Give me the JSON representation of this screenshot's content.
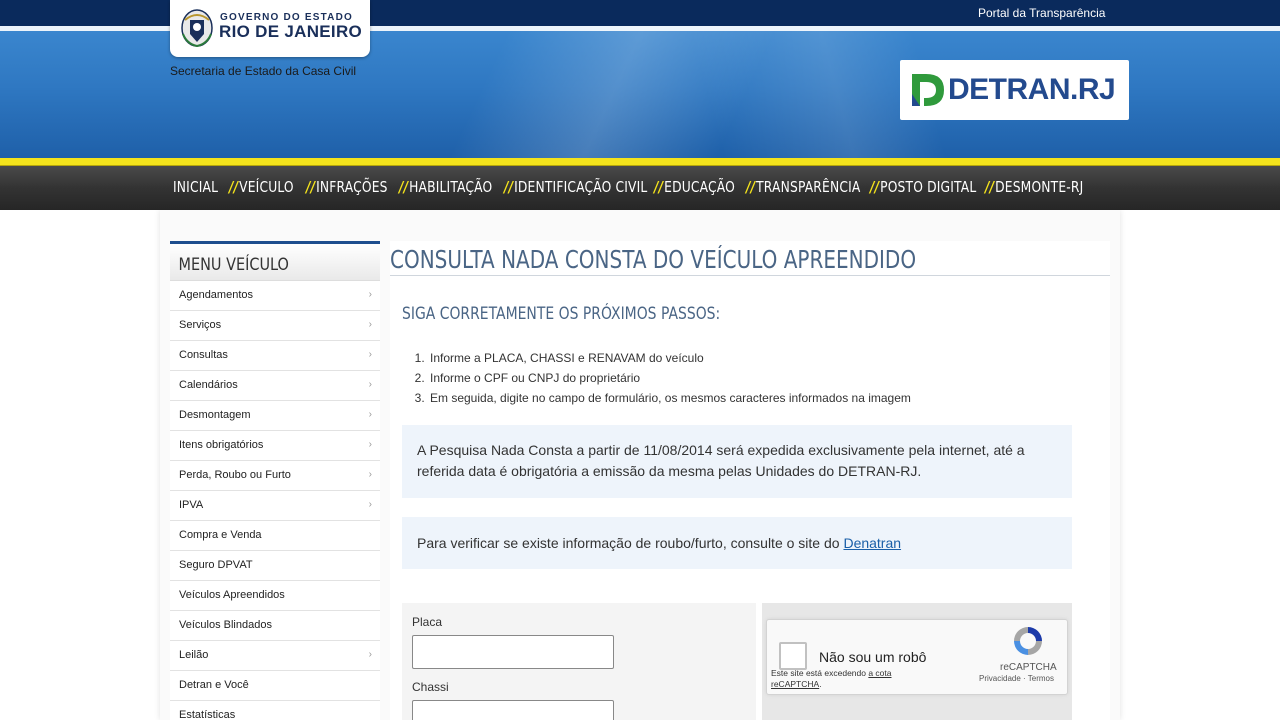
{
  "header": {
    "portal_link": "Portal da Transparência",
    "gov_line1": "GOVERNO DO ESTADO",
    "gov_line2": "RIO DE JANEIRO",
    "secretaria": "Secretaria de Estado da Casa Civil",
    "detran_logo": "DETRAN.RJ"
  },
  "nav": {
    "items": [
      {
        "label": "INICIAL",
        "slash": ""
      },
      {
        "label": "VEÍCULO",
        "slash": "//"
      },
      {
        "label": "INFRAÇÕES",
        "slash": "//"
      },
      {
        "label": "HABILITAÇÃO",
        "slash": "//"
      },
      {
        "label": "IDENTIFICAÇÃO CIVIL",
        "slash": "//"
      },
      {
        "label": "EDUCAÇÃO",
        "slash": "//"
      },
      {
        "label": "TRANSPARÊNCIA",
        "slash": "//"
      },
      {
        "label": "POSTO DIGITAL",
        "slash": "//"
      },
      {
        "label": "DESMONTE-RJ",
        "slash": "//"
      }
    ]
  },
  "sidebar": {
    "title": "MENU VEÍCULO",
    "chevron": "›",
    "items": [
      {
        "label": "Agendamentos",
        "chev": true
      },
      {
        "label": "Serviços",
        "chev": true
      },
      {
        "label": "Consultas",
        "chev": true
      },
      {
        "label": "Calendários",
        "chev": true
      },
      {
        "label": "Desmontagem",
        "chev": true
      },
      {
        "label": "Itens obrigatórios",
        "chev": true
      },
      {
        "label": "Perda, Roubo ou Furto",
        "chev": true
      },
      {
        "label": "IPVA",
        "chev": true
      },
      {
        "label": "Compra e Venda",
        "chev": false
      },
      {
        "label": "Seguro DPVAT",
        "chev": false
      },
      {
        "label": "Veículos Apreendidos",
        "chev": false
      },
      {
        "label": "Veículos Blindados",
        "chev": false
      },
      {
        "label": "Leilão",
        "chev": true
      },
      {
        "label": "Detran e Você",
        "chev": false
      },
      {
        "label": "Estatísticas",
        "chev": false
      }
    ]
  },
  "main": {
    "title": "CONSULTA NADA CONSTA DO VEÍCULO APREENDIDO",
    "steps_title": "SIGA CORRETAMENTE OS PRÓXIMOS PASSOS:",
    "steps": [
      "Informe a PLACA, CHASSI e RENAVAM do veículo",
      "Informe o CPF ou CNPJ do proprietário",
      "Em seguida, digite no campo de formulário, os mesmos caracteres informados na imagem"
    ],
    "notice1": "A Pesquisa Nada Consta a partir de 11/08/2014 será expedida exclusivamente pela internet, até a referida data é obrigatória a emissão da mesma pelas Unidades do DETRAN-RJ.",
    "notice2_text": "Para verificar se existe informação de roubo/furto, consulte o site do ",
    "notice2_link": "Denatran",
    "form": {
      "placa_label": "Placa",
      "placa_value": "",
      "chassi_label": "Chassi",
      "chassi_value": ""
    },
    "recaptcha": {
      "label": "Não sou um robô",
      "warning_prefix": "Este site está excedendo ",
      "warning_link": "a cota reCAPTCHA",
      "warning_suffix": ".",
      "brand": "reCAPTCHA",
      "links": "Privacidade · Termos"
    }
  },
  "colors": {
    "topbar": "#0a2a5c",
    "yellow": "#f4e31c",
    "heading": "#4a6585",
    "link": "#1a5fa8"
  }
}
